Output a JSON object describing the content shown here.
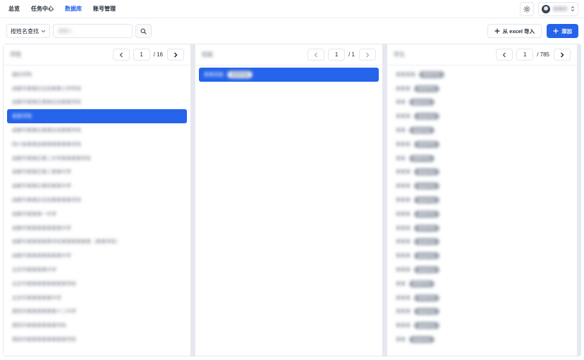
{
  "nav": {
    "items": [
      {
        "label": "总览",
        "active": false
      },
      {
        "label": "任务中心",
        "active": false
      },
      {
        "label": "数据库",
        "active": true
      },
      {
        "label": "账号管理",
        "active": false
      }
    ],
    "username": "管理员"
  },
  "toolbar": {
    "search_mode": "按姓名查找",
    "search_placeholder": "请输入",
    "import_label": "从 excel 导入",
    "add_label": "添加"
  },
  "columns": [
    {
      "title": "学院",
      "page": "1",
      "total": "/ 16",
      "items": [
        {
          "text": "国际学院"
        },
        {
          "text": "成都市某某区实验某某小学学校"
        },
        {
          "text": "成都市某某区某某实验某某学校"
        },
        {
          "text": "某某学院",
          "selected": true
        },
        {
          "text": "成都市某某区某某实验某某学校"
        },
        {
          "text": "四川省某某县某某某某某某学校"
        },
        {
          "text": "成都市某某区第二中学某某某某学校"
        },
        {
          "text": "成都市某某区第三某某中学"
        },
        {
          "text": "成都市某某区第四某某中学"
        },
        {
          "text": "成都市某某区实验某某某某学校"
        },
        {
          "text": "成都市某某第一中学"
        },
        {
          "text": "成都市某某某某某某某中学"
        },
        {
          "text": "成都市某某某某某学校某某某某某某（某某学校）"
        },
        {
          "text": "成都市某某某某某某某中学"
        },
        {
          "text": "北京市某某某某中学"
        },
        {
          "text": "北京市某某某某某某某某学校"
        },
        {
          "text": "北京市某某某某某中学"
        },
        {
          "text": "德阳市某某某某某第十二中学"
        },
        {
          "text": "德阳市某某某某某某学校"
        },
        {
          "text": "德阳市某某某某某某某某学校"
        }
      ]
    },
    {
      "title": "班级",
      "page": "1",
      "total": "/ 1",
      "items": [
        {
          "text": "某某班级",
          "badge": "某某年级",
          "selected": true
        }
      ]
    },
    {
      "title": "学生",
      "page": "1",
      "total": "/ 785",
      "items": [
        {
          "text": "某某某某",
          "badge": "某某学生"
        },
        {
          "text": "某某某",
          "badge": "某某学生"
        },
        {
          "text": "某某",
          "badge": "某某学生"
        },
        {
          "text": "某某某",
          "badge": "某某学生"
        },
        {
          "text": "某某",
          "badge": "某某学生"
        },
        {
          "text": "某某某",
          "badge": "某某学生"
        },
        {
          "text": "某某",
          "badge": "某某学生"
        },
        {
          "text": "某某某",
          "badge": "某某学生"
        },
        {
          "text": "某某某",
          "badge": "某某学生"
        },
        {
          "text": "某某某",
          "badge": "某某学生"
        },
        {
          "text": "某某某",
          "badge": "某某学生"
        },
        {
          "text": "某某某",
          "badge": "某某学生"
        },
        {
          "text": "某某某",
          "badge": "某某学生"
        },
        {
          "text": "某某某",
          "badge": "某某学生"
        },
        {
          "text": "某某某",
          "badge": "某某学生"
        },
        {
          "text": "某某",
          "badge": "某某学生"
        },
        {
          "text": "某某某",
          "badge": "某某学生"
        },
        {
          "text": "某某某",
          "badge": "某某学生"
        },
        {
          "text": "某某某",
          "badge": "某某学生"
        },
        {
          "text": "某某",
          "badge": "某某学生"
        }
      ]
    }
  ],
  "colors": {
    "accent": "#2563eb",
    "border": "#e5e7eb",
    "gutter": "#e5e9ef"
  }
}
